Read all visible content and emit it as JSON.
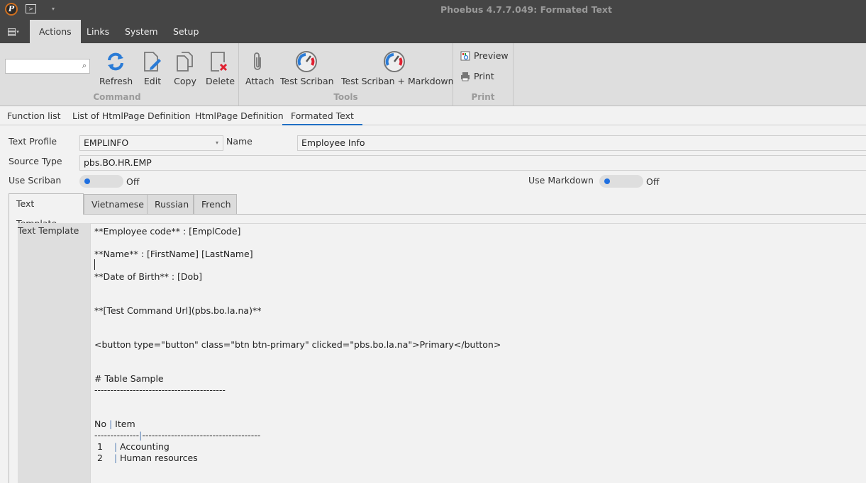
{
  "window": {
    "title": "Phoebus 4.7.7.049: Formated Text",
    "app_logo": "phoebus-logo",
    "quick_access": {
      "icon": "terminal-icon",
      "glyph": ">",
      "dropdown": "▾"
    }
  },
  "menubar": {
    "app_menu_icon": "▤",
    "tabs": [
      {
        "label": "Actions",
        "active": true
      },
      {
        "label": "Links",
        "active": false
      },
      {
        "label": "System",
        "active": false
      },
      {
        "label": "Setup",
        "active": false
      }
    ]
  },
  "ribbon": {
    "search": {
      "value": "",
      "placeholder": "",
      "icon": "⌕"
    },
    "groups": [
      {
        "label": "Command",
        "buttons": [
          {
            "label": "Refresh",
            "icon": "refresh-icon"
          },
          {
            "label": "Edit",
            "icon": "edit-icon"
          },
          {
            "label": "Copy",
            "icon": "copy-icon"
          },
          {
            "label": "Delete",
            "icon": "delete-icon"
          }
        ]
      },
      {
        "label": "Tools",
        "buttons": [
          {
            "label": "Attach",
            "icon": "paperclip-icon"
          },
          {
            "label": "Test Scriban",
            "icon": "gauge-icon"
          },
          {
            "label": "Test Scriban + Markdown",
            "icon": "gauge-icon"
          }
        ]
      },
      {
        "label": "Print",
        "buttons": [
          {
            "label": "Preview",
            "icon": "preview-icon"
          },
          {
            "label": "Print",
            "icon": "printer-icon"
          }
        ]
      }
    ]
  },
  "document_tabs": [
    {
      "label": "Function list",
      "active": false
    },
    {
      "label": "List of HtmlPage Definition",
      "active": false
    },
    {
      "label": "HtmlPage Definition",
      "active": false
    },
    {
      "label": "Formated Text",
      "active": true
    }
  ],
  "form": {
    "text_profile": {
      "label": "Text Profile",
      "value": "EMPLINFO",
      "arrow": "▾"
    },
    "name": {
      "label": "Name",
      "value": "Employee Info"
    },
    "source_type": {
      "label": "Source Type",
      "value": "pbs.BO.HR.EMP"
    },
    "use_scriban": {
      "label": "Use Scriban",
      "state": "Off",
      "on": false
    },
    "use_markdown": {
      "label": "Use Markdown",
      "state": "Off",
      "on": false
    }
  },
  "inner_tabs": [
    {
      "label": "Text Template",
      "active": true
    },
    {
      "label": "Vietnamese",
      "active": false
    },
    {
      "label": "Russian",
      "active": false
    },
    {
      "label": "French",
      "active": false
    }
  ],
  "template": {
    "label": "Text Template",
    "lines": [
      "**Employee code** : [EmplCode]",
      "",
      "**Name** : [FirstName] [LastName]",
      "",
      "**Date of Birth** : [Dob]",
      "",
      "",
      "**[Test Command Url](pbs.bo.la.na)**",
      "",
      "",
      "<button type=\"button\" class=\"btn btn-primary\" clicked=\"pbs.bo.la.na\">Primary</button>",
      "",
      "",
      "# Table Sample",
      "-----------------------------------------",
      "",
      "",
      "No | Item",
      "--------------|-------------------------------------",
      " 1    | Accounting",
      " 2    | Human resources"
    ]
  },
  "colors": {
    "titlebar": "#454545",
    "ribbon": "#dedede",
    "accent": "#1f6fc4",
    "toggle_knob": "#1f6fe0"
  }
}
